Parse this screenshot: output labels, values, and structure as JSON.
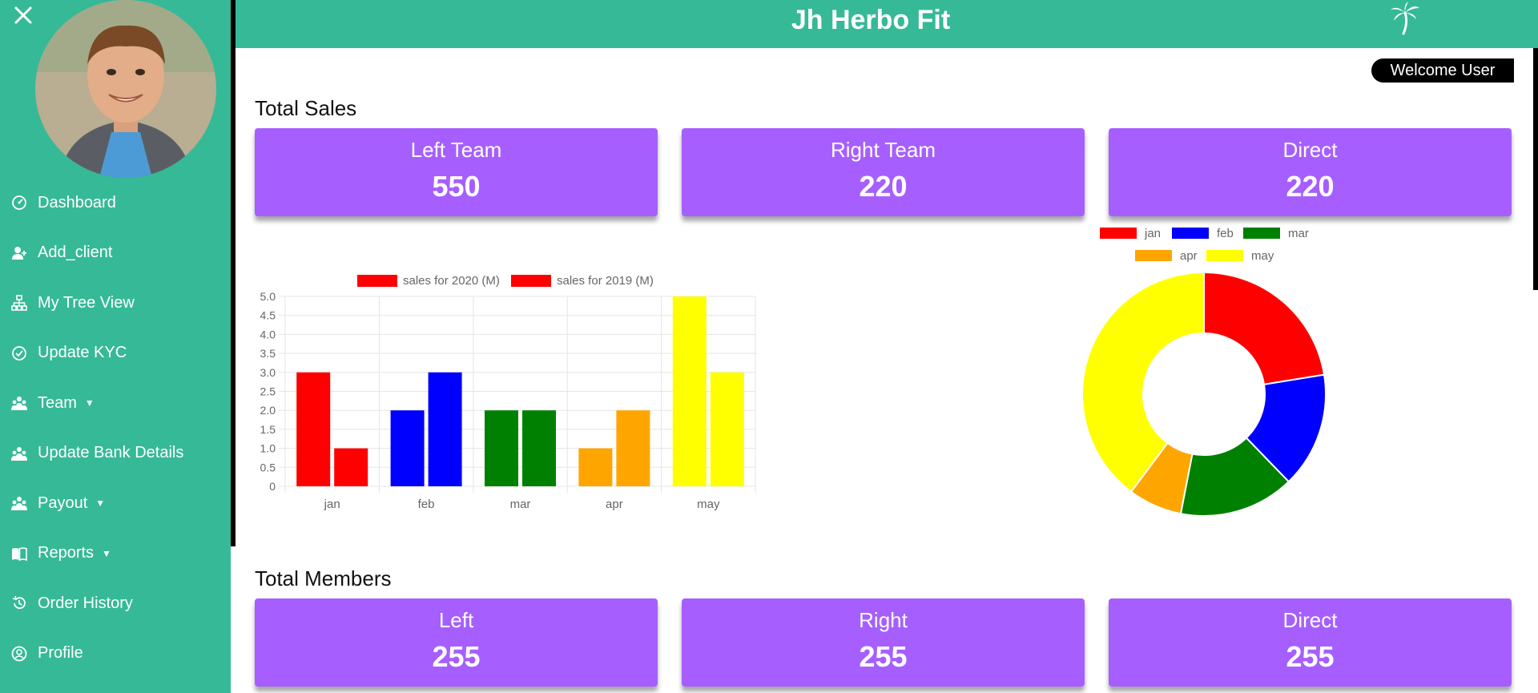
{
  "app": {
    "title": "Jh Herbo Fit",
    "welcome": "Welcome User"
  },
  "sidebar": {
    "items": [
      {
        "label": "Dashboard",
        "icon": "dashboard-icon",
        "caret": false
      },
      {
        "label": "Add_client",
        "icon": "add-user-icon",
        "caret": false
      },
      {
        "label": "My Tree View",
        "icon": "tree-icon",
        "caret": false
      },
      {
        "label": "Update KYC",
        "icon": "check-circle-icon",
        "caret": false
      },
      {
        "label": "Team",
        "icon": "users-icon",
        "caret": true
      },
      {
        "label": "Update Bank Details",
        "icon": "users-icon",
        "caret": false
      },
      {
        "label": "Payout",
        "icon": "users-icon",
        "caret": true
      },
      {
        "label": "Reports",
        "icon": "book-icon",
        "caret": true
      },
      {
        "label": "Order History",
        "icon": "history-icon",
        "caret": false
      },
      {
        "label": "Profile",
        "icon": "user-circle-icon",
        "caret": false
      }
    ]
  },
  "sales": {
    "title": "Total Sales",
    "cards": [
      {
        "label": "Left Team",
        "value": "550"
      },
      {
        "label": "Right Team",
        "value": "220"
      },
      {
        "label": "Direct",
        "value": "220"
      }
    ]
  },
  "members": {
    "title": "Total Members",
    "cards": [
      {
        "label": "Left",
        "value": "255"
      },
      {
        "label": "Right",
        "value": "255"
      },
      {
        "label": "Direct",
        "value": "255"
      }
    ]
  },
  "colors": {
    "accent": "#36b997",
    "card": "#a65ffe",
    "months": [
      "#ff0000",
      "#0000ff",
      "#008000",
      "#ffa500",
      "#ffff00"
    ]
  },
  "chart_data": [
    {
      "type": "bar",
      "categories": [
        "jan",
        "feb",
        "mar",
        "apr",
        "may"
      ],
      "series": [
        {
          "name": "sales for 2020 (M)",
          "values": [
            3,
            2,
            2,
            1,
            5
          ]
        },
        {
          "name": "sales for 2019 (M)",
          "values": [
            1,
            3,
            2,
            2,
            3
          ]
        }
      ],
      "ylim": [
        0,
        5
      ],
      "yticks": [
        "0",
        "0.5",
        "1.0",
        "1.5",
        "2.0",
        "2.5",
        "3.0",
        "3.5",
        "4.0",
        "4.5",
        "5.0"
      ],
      "legend_color": "#ff0000",
      "grid": true,
      "legend": "top"
    },
    {
      "type": "pie",
      "style": "doughnut",
      "labels": [
        "jan",
        "feb",
        "mar",
        "apr",
        "may"
      ],
      "values": [
        22,
        15,
        15,
        7,
        39
      ],
      "legend": "top"
    }
  ]
}
